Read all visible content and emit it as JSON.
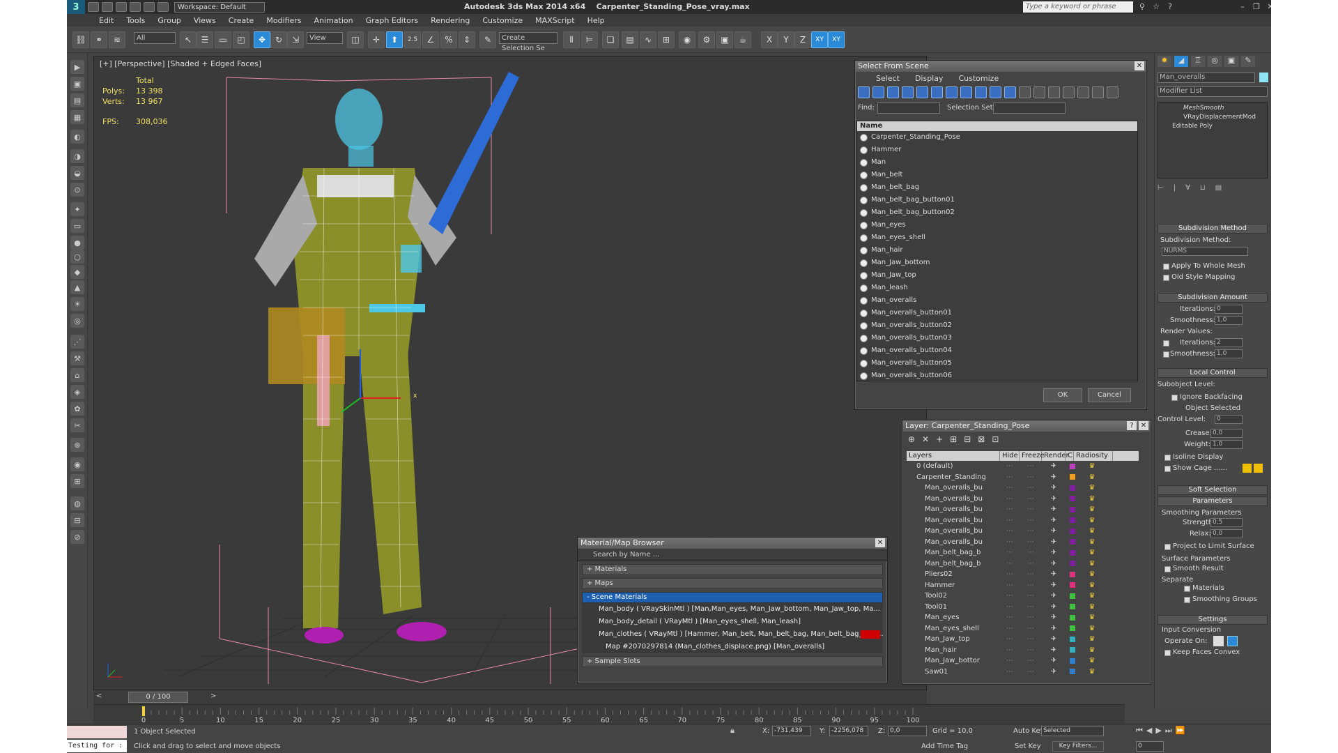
{
  "title": {
    "app": "Autodesk 3ds Max  2014 x64",
    "file": "Carpenter_Standing_Pose_vray.max",
    "workspace": "Workspace: Default",
    "search_placeholder": "Type a keyword or phrase"
  },
  "menu": [
    "Edit",
    "Tools",
    "Group",
    "Views",
    "Create",
    "Modifiers",
    "Animation",
    "Graph Editors",
    "Rendering",
    "Customize",
    "MAXScript",
    "Help"
  ],
  "toolbar": {
    "filter": "All",
    "refcoord": "View",
    "selset": "Create Selection Se",
    "angle": "2.5",
    "pct": "%",
    "axes": [
      "X",
      "Y",
      "Z",
      "XY",
      "XY"
    ]
  },
  "viewport": {
    "label": "[+] [Perspective] [Shaded + Edged Faces]",
    "stats": {
      "total": "Total",
      "polys_label": "Polys:",
      "polys": "13 398",
      "verts_label": "Verts:",
      "verts": "13 967",
      "fps_label": "FPS:",
      "fps": "308,036"
    },
    "axis": "x"
  },
  "sfs": {
    "title": "Select From Scene",
    "tabs": [
      "Select",
      "Display",
      "Customize"
    ],
    "find": "Find:",
    "selset": "Selection Set:",
    "col": "Name",
    "items": [
      "Carpenter_Standing_Pose",
      "Hammer",
      "Man",
      "Man_belt",
      "Man_belt_bag",
      "Man_belt_bag_button01",
      "Man_belt_bag_button02",
      "Man_eyes",
      "Man_eyes_shell",
      "Man_hair",
      "Man_Jaw_bottom",
      "Man_Jaw_top",
      "Man_leash",
      "Man_overalls",
      "Man_overalls_button01",
      "Man_overalls_button02",
      "Man_overalls_button03",
      "Man_overalls_button04",
      "Man_overalls_button05",
      "Man_overalls_button06"
    ],
    "ok": "OK",
    "cancel": "Cancel"
  },
  "layers": {
    "title": "Layer: Carpenter_Standing_Pose",
    "help": "?",
    "cols": [
      "Layers",
      "Hide",
      "Freeze",
      "Render",
      "C",
      "Radiosity"
    ],
    "rows": [
      {
        "n": "0 (default)",
        "c": "#c040c0"
      },
      {
        "n": "Carpenter_Standing",
        "c": "#f0a020"
      },
      {
        "n": "Man_overalls_bu",
        "c": "#8020a0"
      },
      {
        "n": "Man_overalls_bu",
        "c": "#8020a0"
      },
      {
        "n": "Man_overalls_bu",
        "c": "#8020a0"
      },
      {
        "n": "Man_overalls_bu",
        "c": "#8020a0"
      },
      {
        "n": "Man_overalls_bu",
        "c": "#8020a0"
      },
      {
        "n": "Man_overalls_bu",
        "c": "#8020a0"
      },
      {
        "n": "Man_belt_bag_b",
        "c": "#8020a0"
      },
      {
        "n": "Man_belt_bag_b",
        "c": "#8020a0"
      },
      {
        "n": "Pliers02",
        "c": "#e03080"
      },
      {
        "n": "Hammer",
        "c": "#e03080"
      },
      {
        "n": "Tool02",
        "c": "#40c040"
      },
      {
        "n": "Tool01",
        "c": "#40c040"
      },
      {
        "n": "Man_eyes",
        "c": "#40c040"
      },
      {
        "n": "Man_eyes_shell",
        "c": "#40c040"
      },
      {
        "n": "Man_Jaw_top",
        "c": "#30b0c0"
      },
      {
        "n": "Man_hair",
        "c": "#30b0c0"
      },
      {
        "n": "Man_Jaw_bottor",
        "c": "#3080d0"
      },
      {
        "n": "Saw01",
        "c": "#3080d0"
      }
    ]
  },
  "mat": {
    "title": "Material/Map Browser",
    "search": "Search by Name ...",
    "materials": "+ Materials",
    "maps": "+ Maps",
    "scene": "- Scene Materials",
    "rows": [
      "Man_body  ( VRaySkinMtl ) [Man,Man_eyes, Man_Jaw_bottom, Man_Jaw_top, Ma...",
      "Man_body_detail  ( VRayMtl ) [Man_eyes_shell, Man_leash]",
      "Man_clothes  ( VRayMtl ) [Hammer, Man_belt, Man_belt_bag, Man_belt_bag_butt...",
      "Map #2070297814 (Man_clothes_displace.png) [Man_overalls]"
    ],
    "slots": "+ Sample Slots"
  },
  "cmd": {
    "objname": "Man_overalls",
    "modlist": "Modifier List",
    "stack": [
      "MeshSmooth",
      "VRayDisplacementMod",
      "Editable Poly"
    ],
    "subdiv_method_hdr": "Subdivision Method",
    "subdiv_method_lbl": "Subdivision Method:",
    "subdiv_method": "NURMS",
    "apply_whole": "Apply To Whole Mesh",
    "old_style": "Old Style Mapping",
    "amount_hdr": "Subdivision Amount",
    "iterations": "Iterations:",
    "iter_val": "0",
    "smoothness": "Smoothness:",
    "smooth_val": "1,0",
    "render_values": "Render Values:",
    "r_iter_val": "2",
    "r_smooth_val": "1,0",
    "local_hdr": "Local Control",
    "sublevel": "Subobject Level:",
    "ignore_bf": "Ignore Backfacing",
    "obj_sel": "Object Selected",
    "control_level": "Control Level:",
    "ctrl_val": "0",
    "crease": "Crease:",
    "crease_val": "0,0",
    "weight": "Weight:",
    "weight_val": "1,0",
    "isoline": "Isoline Display",
    "cage": "Show Cage ......",
    "soft_hdr": "Soft Selection",
    "params_hdr": "Parameters",
    "smooth_params": "Smoothing Parameters",
    "strength": "Strength:",
    "strength_val": "0,5",
    "relax": "Relax:",
    "relax_val": "0,0",
    "project": "Project to Limit Surface",
    "surface_params": "Surface Parameters",
    "smooth_result": "Smooth Result",
    "separate": "Separate",
    "materials": "Materials",
    "smoothing_groups": "Smoothing Groups",
    "settings_hdr": "Settings",
    "input_conv": "Input Conversion",
    "operate_on": "Operate On:",
    "keep_faces": "Keep Faces Convex"
  },
  "timeline": {
    "frame": "0 / 100",
    "ticks": [
      "0",
      "5",
      "10",
      "15",
      "20",
      "25",
      "30",
      "35",
      "40",
      "45",
      "50",
      "55",
      "60",
      "65",
      "70",
      "75",
      "80",
      "85",
      "90",
      "95",
      "100"
    ]
  },
  "status": {
    "testing": "Testing for :",
    "selected": "1 Object Selected",
    "prompt": "Click and drag to select and move objects",
    "x_lbl": "X:",
    "x": "-731,439",
    "y_lbl": "Y:",
    "y": "-2256,078",
    "z_lbl": "Z:",
    "z": "0,0",
    "grid": "Grid = 10,0",
    "addtime": "Add Time Tag",
    "autokey": "Auto Key",
    "setkey": "Set Key",
    "selmode": "Selected",
    "keyfilters": "Key Filters...",
    "frame": "0"
  }
}
